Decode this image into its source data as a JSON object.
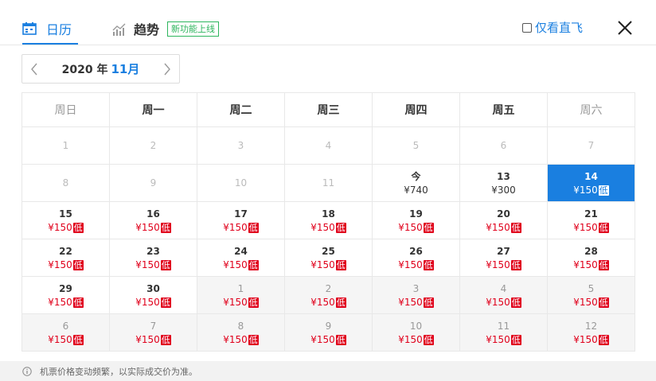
{
  "tabs": {
    "calendar_label": "日历",
    "trend_label": "趋势",
    "new_badge": "新功能上线"
  },
  "filter": {
    "direct_only_label": "仅看直飞"
  },
  "month_nav": {
    "year_label": "2020 年",
    "month_label": "11月"
  },
  "weekdays": [
    "周日",
    "周一",
    "周二",
    "周三",
    "周四",
    "周五",
    "周六"
  ],
  "low_label": "低",
  "weeks": [
    [
      {
        "day": "1",
        "state": "past"
      },
      {
        "day": "2",
        "state": "past"
      },
      {
        "day": "3",
        "state": "past"
      },
      {
        "day": "4",
        "state": "past"
      },
      {
        "day": "5",
        "state": "past"
      },
      {
        "day": "6",
        "state": "past"
      },
      {
        "day": "7",
        "state": "past"
      }
    ],
    [
      {
        "day": "8",
        "state": "past"
      },
      {
        "day": "9",
        "state": "past"
      },
      {
        "day": "10",
        "state": "past"
      },
      {
        "day": "11",
        "state": "past"
      },
      {
        "day": "今",
        "price": "¥740",
        "state": "normal"
      },
      {
        "day": "13",
        "price": "¥300",
        "state": "normal"
      },
      {
        "day": "14",
        "price": "¥150",
        "low": true,
        "state": "selected"
      }
    ],
    [
      {
        "day": "15",
        "price": "¥150",
        "low": true,
        "state": "cheap"
      },
      {
        "day": "16",
        "price": "¥150",
        "low": true,
        "state": "cheap"
      },
      {
        "day": "17",
        "price": "¥150",
        "low": true,
        "state": "cheap"
      },
      {
        "day": "18",
        "price": "¥150",
        "low": true,
        "state": "cheap"
      },
      {
        "day": "19",
        "price": "¥150",
        "low": true,
        "state": "cheap"
      },
      {
        "day": "20",
        "price": "¥150",
        "low": true,
        "state": "cheap"
      },
      {
        "day": "21",
        "price": "¥150",
        "low": true,
        "state": "cheap"
      }
    ],
    [
      {
        "day": "22",
        "price": "¥150",
        "low": true,
        "state": "cheap"
      },
      {
        "day": "23",
        "price": "¥150",
        "low": true,
        "state": "cheap"
      },
      {
        "day": "24",
        "price": "¥150",
        "low": true,
        "state": "cheap"
      },
      {
        "day": "25",
        "price": "¥150",
        "low": true,
        "state": "cheap"
      },
      {
        "day": "26",
        "price": "¥150",
        "low": true,
        "state": "cheap"
      },
      {
        "day": "27",
        "price": "¥150",
        "low": true,
        "state": "cheap"
      },
      {
        "day": "28",
        "price": "¥150",
        "low": true,
        "state": "cheap"
      }
    ],
    [
      {
        "day": "29",
        "price": "¥150",
        "low": true,
        "state": "cheap"
      },
      {
        "day": "30",
        "price": "¥150",
        "low": true,
        "state": "cheap"
      },
      {
        "day": "1",
        "price": "¥150",
        "low": true,
        "state": "other"
      },
      {
        "day": "2",
        "price": "¥150",
        "low": true,
        "state": "other"
      },
      {
        "day": "3",
        "price": "¥150",
        "low": true,
        "state": "other"
      },
      {
        "day": "4",
        "price": "¥150",
        "low": true,
        "state": "other"
      },
      {
        "day": "5",
        "price": "¥150",
        "low": true,
        "state": "other"
      }
    ],
    [
      {
        "day": "6",
        "price": "¥150",
        "low": true,
        "state": "other"
      },
      {
        "day": "7",
        "price": "¥150",
        "low": true,
        "state": "other"
      },
      {
        "day": "8",
        "price": "¥150",
        "low": true,
        "state": "other"
      },
      {
        "day": "9",
        "price": "¥150",
        "low": true,
        "state": "other"
      },
      {
        "day": "10",
        "price": "¥150",
        "low": true,
        "state": "other"
      },
      {
        "day": "11",
        "price": "¥150",
        "low": true,
        "state": "other"
      },
      {
        "day": "12",
        "price": "¥150",
        "low": true,
        "state": "other"
      }
    ]
  ],
  "footer": {
    "note": "机票价格变动频繁，以实际成交价为准。"
  },
  "colors": {
    "accent": "#1a7fe0",
    "low_price": "#e0001b",
    "new_badge": "#2db55d"
  }
}
